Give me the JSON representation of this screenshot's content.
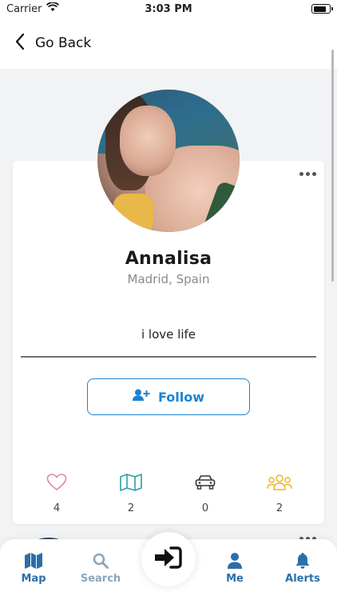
{
  "status": {
    "carrier": "Carrier",
    "time": "3:03 PM"
  },
  "nav": {
    "back_label": "Go Back"
  },
  "profile": {
    "name": "Annalisa",
    "location": "Madrid, Spain",
    "bio": "i love life",
    "follow_label": "Follow"
  },
  "stats": [
    {
      "icon": "heart-icon",
      "value": "4",
      "color": "#e08a9a"
    },
    {
      "icon": "map-icon",
      "value": "2",
      "color": "#2aa0a8"
    },
    {
      "icon": "car-icon",
      "value": "0",
      "color": "#333333"
    },
    {
      "icon": "group-icon",
      "value": "2",
      "color": "#f0b429"
    }
  ],
  "tabs": [
    {
      "icon": "map-icon",
      "label": "Map"
    },
    {
      "icon": "search-icon",
      "label": "Search"
    },
    {
      "icon": "sign-in-icon",
      "label": ""
    },
    {
      "icon": "user-icon",
      "label": "Me"
    },
    {
      "icon": "bell-icon",
      "label": "Alerts"
    }
  ],
  "colors": {
    "accent": "#1b83d4",
    "tab_active": "#2b6fa8",
    "tab_inactive": "#8aa6bd"
  }
}
